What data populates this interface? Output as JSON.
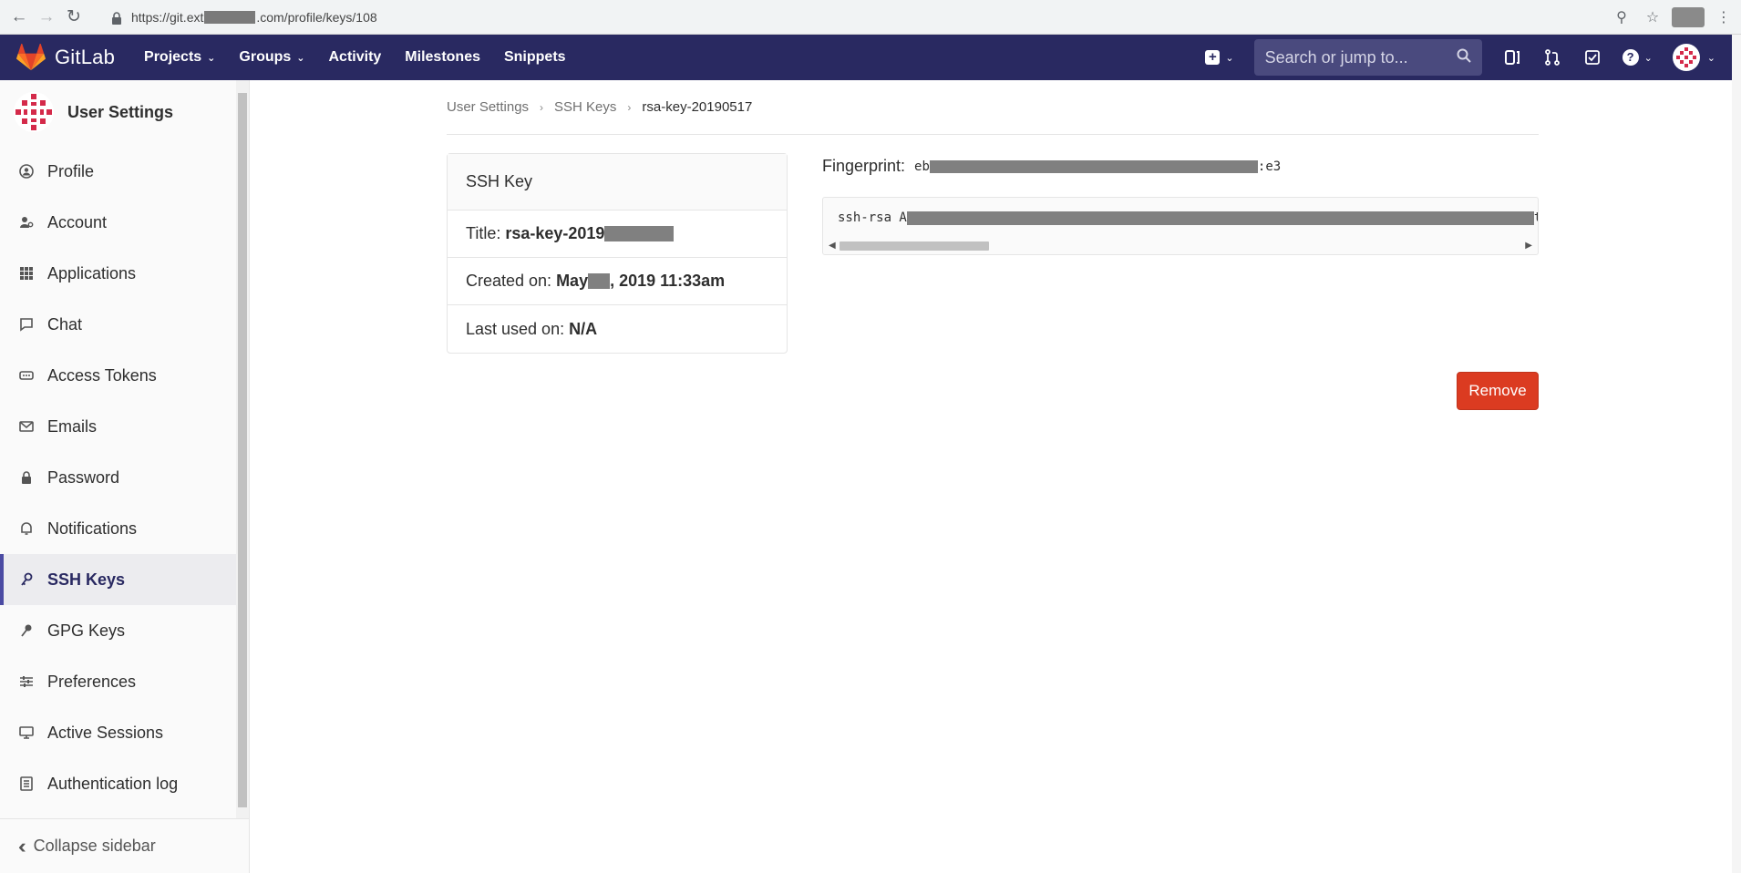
{
  "browser": {
    "url_prefix": "https://git.ext",
    "url_suffix": ".com/profile/keys/108"
  },
  "header": {
    "logo_text": "GitLab",
    "nav": [
      "Projects",
      "Groups",
      "Activity",
      "Milestones",
      "Snippets"
    ],
    "search_placeholder": "Search or jump to..."
  },
  "sidebar": {
    "title": "User Settings",
    "items": [
      {
        "label": "Profile",
        "icon": "profile-icon"
      },
      {
        "label": "Account",
        "icon": "account-icon"
      },
      {
        "label": "Applications",
        "icon": "applications-icon"
      },
      {
        "label": "Chat",
        "icon": "chat-icon"
      },
      {
        "label": "Access Tokens",
        "icon": "access-tokens-icon"
      },
      {
        "label": "Emails",
        "icon": "emails-icon"
      },
      {
        "label": "Password",
        "icon": "password-icon"
      },
      {
        "label": "Notifications",
        "icon": "notifications-icon"
      },
      {
        "label": "SSH Keys",
        "icon": "key-icon",
        "active": true
      },
      {
        "label": "GPG Keys",
        "icon": "key-icon"
      },
      {
        "label": "Preferences",
        "icon": "preferences-icon"
      },
      {
        "label": "Active Sessions",
        "icon": "active-sessions-icon"
      },
      {
        "label": "Authentication log",
        "icon": "authentication-log-icon"
      }
    ],
    "collapse_label": "Collapse sidebar"
  },
  "breadcrumb": {
    "items": [
      "User Settings",
      "SSH Keys"
    ],
    "current": "rsa-key-20190517"
  },
  "key_card": {
    "heading": "SSH Key",
    "title_label": "Title:",
    "title_value": "rsa-key-2019",
    "created_label": "Created on:",
    "created_value_start": "May",
    "created_value_end": ", 2019 11:33am",
    "last_used_label": "Last used on:",
    "last_used_value": "N/A"
  },
  "fingerprint": {
    "label": "Fingerprint:",
    "value_start": "eb",
    "value_end": ":e3"
  },
  "public_key": {
    "value_start": "ssh-rsa A",
    "value_end": "t"
  },
  "actions": {
    "remove_label": "Remove"
  },
  "colors": {
    "header_bg": "#292961",
    "remove_button": "#db3b21",
    "active_accent": "#4b4ba3"
  }
}
